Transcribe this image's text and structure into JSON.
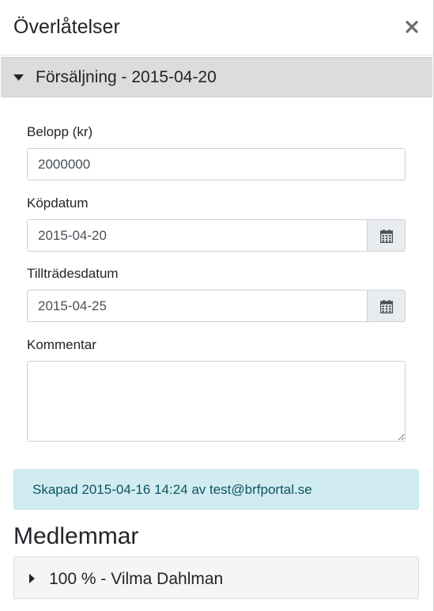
{
  "modal": {
    "title": "Överlåtelser"
  },
  "transfer": {
    "heading": "Försäljning - 2015-04-20",
    "amount_label": "Belopp (kr)",
    "amount_value": "2000000",
    "purchase_date_label": "Köpdatum",
    "purchase_date_value": "2015-04-20",
    "access_date_label": "Tillträdesdatum",
    "access_date_value": "2015-04-25",
    "comment_label": "Kommentar",
    "comment_value": ""
  },
  "info": {
    "created_text": "Skapad 2015-04-16 14:24 av test@brfportal.se"
  },
  "members": {
    "title": "Medlemmar",
    "items": [
      {
        "label": "100 % - Vilma Dahlman"
      }
    ]
  },
  "icons": {
    "close": "close-icon",
    "expanded_caret": "caret-down-icon",
    "collapsed_caret": "caret-right-icon",
    "calendar": "calendar-icon"
  }
}
